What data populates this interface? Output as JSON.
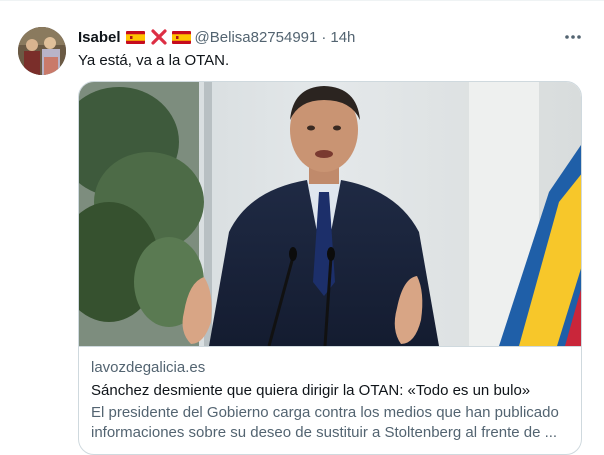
{
  "tweet": {
    "author_name": "Isabel",
    "handle": "@Belisa82754991",
    "separator": "·",
    "time": "14h",
    "text": "Ya está, va a la OTAN.",
    "header_icons": [
      "spain-flag-icon",
      "red-x-icon",
      "spain-flag-icon"
    ],
    "more_icon": "more-options-icon"
  },
  "card": {
    "domain": "lavozdegalicia.es",
    "title": "Sánchez desmiente que quiera dirigir la OTAN: «Todo es un bulo»",
    "description_line1": "El presidente del Gobierno carga contra los medios que han publicado",
    "description_line2": "informaciones sobre su deseo de sustituir a Stoltenberg al frente de ..."
  },
  "colors": {
    "text_primary": "#0f1419",
    "text_secondary": "#536471",
    "border": "#cfd9de",
    "flag_red": "#c60b1e",
    "flag_yellow": "#ffc400",
    "x_red": "#dd2e44"
  }
}
